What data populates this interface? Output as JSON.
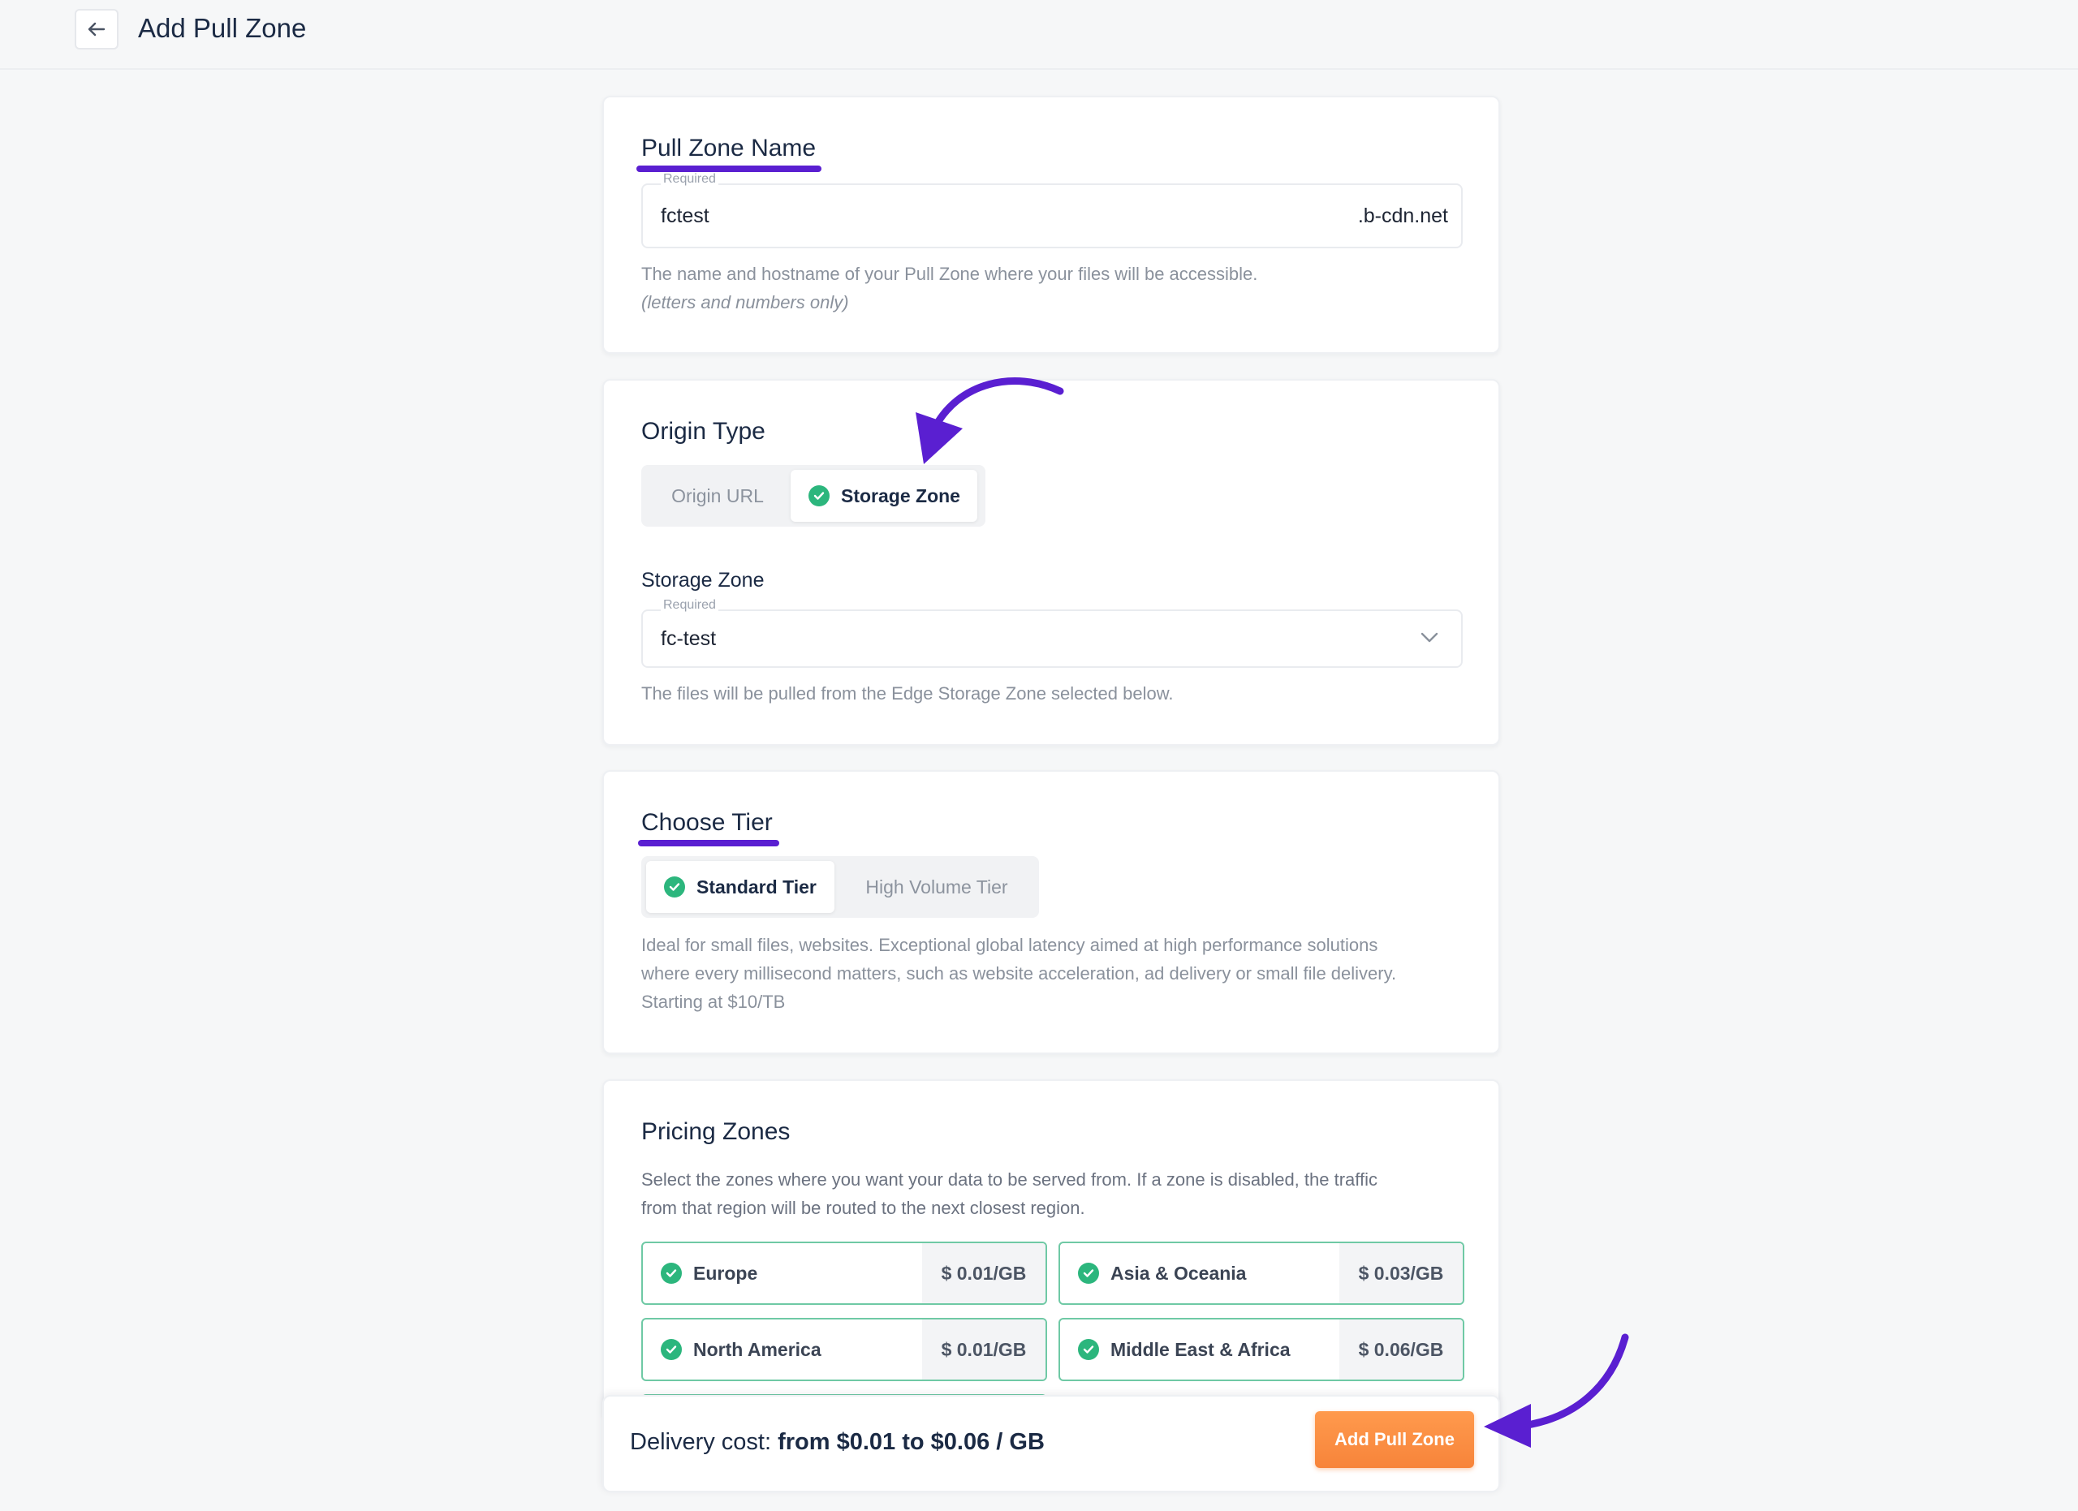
{
  "header": {
    "title": "Add Pull Zone"
  },
  "pull_zone_name": {
    "title": "Pull Zone Name",
    "field_label": "Required",
    "value": "fctest",
    "suffix": ".b-cdn.net",
    "help_line1": "The name and hostname of your Pull Zone where your files will be accessible.",
    "help_line2": "(letters and numbers only)"
  },
  "origin_type": {
    "title": "Origin Type",
    "options": [
      {
        "label": "Origin URL",
        "selected": false
      },
      {
        "label": "Storage Zone",
        "selected": true
      }
    ],
    "storage_zone_label": "Storage Zone",
    "field_label": "Required",
    "selected_value": "fc-test",
    "help": "The files will be pulled from the Edge Storage Zone selected below."
  },
  "choose_tier": {
    "title": "Choose Tier",
    "options": [
      {
        "label": "Standard Tier",
        "selected": true
      },
      {
        "label": "High Volume Tier",
        "selected": false
      }
    ],
    "help_line1": "Ideal for small files, websites. Exceptional global latency aimed at high performance solutions",
    "help_line2": "where every millisecond matters, such as website acceleration, ad delivery or small file delivery.",
    "help_line3": "Starting at $10/TB"
  },
  "pricing_zones": {
    "title": "Pricing Zones",
    "help_line1": "Select the zones where you want your data to be served from. If a zone is disabled, the traffic",
    "help_line2": "from that region will be routed to the next closest region.",
    "zones": [
      {
        "name": "Europe",
        "price": "$ 0.01/GB",
        "enabled": true
      },
      {
        "name": "Asia & Oceania",
        "price": "$ 0.03/GB",
        "enabled": true
      },
      {
        "name": "North America",
        "price": "$ 0.01/GB",
        "enabled": true
      },
      {
        "name": "Middle East & Africa",
        "price": "$ 0.06/GB",
        "enabled": true
      }
    ]
  },
  "footer": {
    "cost_label": "Delivery cost:",
    "cost_value": "from $0.01 to $0.06 / GB",
    "add_button": "Add Pull Zone"
  },
  "colors": {
    "accent_purple": "#5a1fd1",
    "check_green": "#2cb67d",
    "button_orange": "#f7843a"
  }
}
